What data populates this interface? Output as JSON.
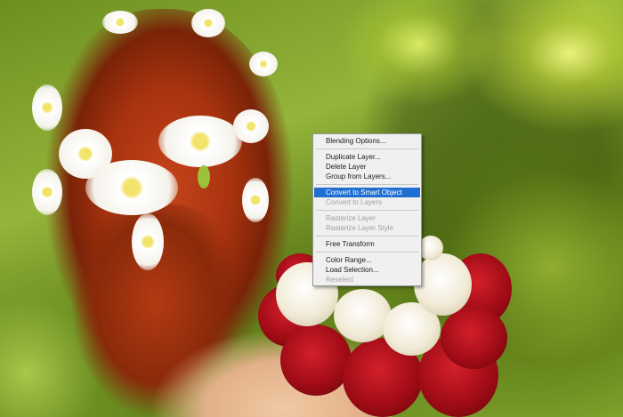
{
  "context_menu": {
    "groups": [
      [
        {
          "label": "Blending Options...",
          "enabled": true
        }
      ],
      [
        {
          "label": "Duplicate Layer...",
          "enabled": true
        },
        {
          "label": "Delete Layer",
          "enabled": true
        },
        {
          "label": "Group from Layers...",
          "enabled": true
        }
      ],
      [
        {
          "label": "Convert to Smart Object",
          "enabled": true,
          "highlighted": true
        },
        {
          "label": "Convert to Layers",
          "enabled": false
        }
      ],
      [
        {
          "label": "Rasterize Layer",
          "enabled": false
        },
        {
          "label": "Rasterize Layer Style",
          "enabled": false
        }
      ],
      [
        {
          "label": "Free Transform",
          "enabled": true
        }
      ],
      [
        {
          "label": "Color Range...",
          "enabled": true
        },
        {
          "label": "Load Selection...",
          "enabled": true
        },
        {
          "label": "Reselect",
          "enabled": false
        }
      ]
    ],
    "highlight_color": "#1f6fd1"
  }
}
